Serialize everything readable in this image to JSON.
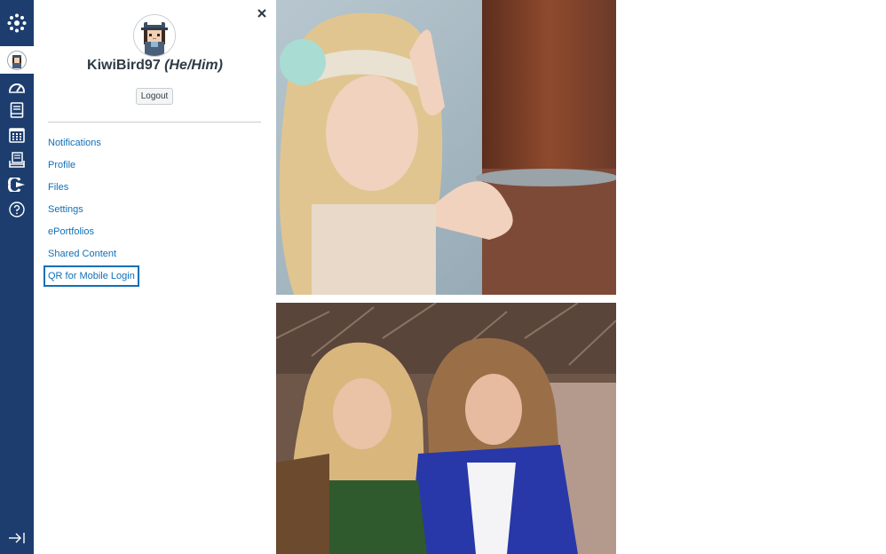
{
  "global_nav": {
    "logo_icon": "canvas-logo-icon",
    "account_icon": "avatar-icon",
    "items": [
      {
        "icon": "dashboard-icon"
      },
      {
        "icon": "courses-icon"
      },
      {
        "icon": "calendar-icon"
      },
      {
        "icon": "inbox-icon"
      },
      {
        "icon": "commons-icon"
      },
      {
        "icon": "help-icon"
      }
    ],
    "collapse_icon": "collapse-nav-icon"
  },
  "account_tray": {
    "close_icon": "close-icon",
    "user_name": "KiwiBird97",
    "pronouns": "(He/Him)",
    "logout_label": "Logout",
    "links": [
      {
        "label": "Notifications"
      },
      {
        "label": "Profile"
      },
      {
        "label": "Files"
      },
      {
        "label": "Settings"
      },
      {
        "label": "ePortfolios"
      },
      {
        "label": "Shared Content"
      },
      {
        "label": "QR for Mobile Login"
      }
    ]
  },
  "colors": {
    "nav_background": "#1c3d6e",
    "link": "#0f70b8",
    "text": "#2d3b45"
  }
}
